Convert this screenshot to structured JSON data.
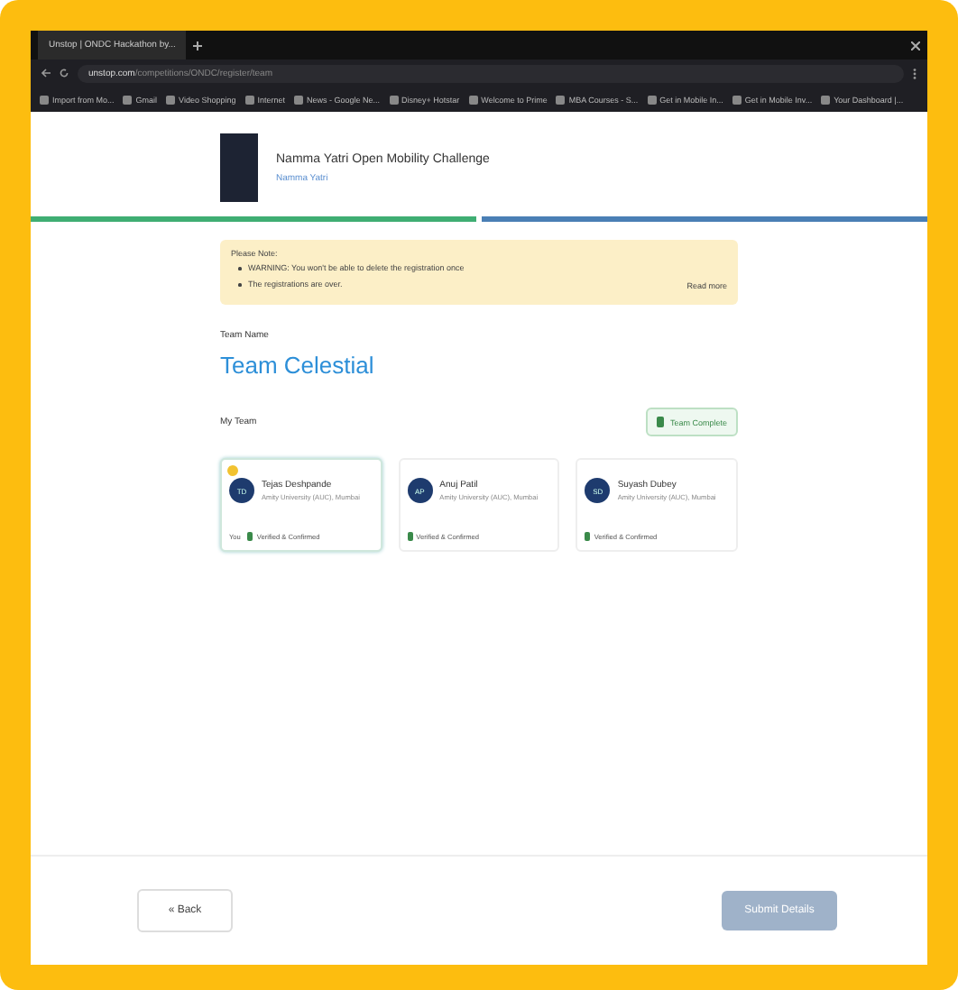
{
  "browser": {
    "tab_title": "Unstop | ONDC Hackathon by...",
    "url_domain": "unstop.com",
    "url_path": "/competitions/ONDC/register/team",
    "bookmarks": [
      "Import from Mo...",
      "Gmail",
      "Video Shopping",
      "Internet",
      "News - Google Ne...",
      "Disney+ Hotstar",
      "Welcome to Prime",
      "MBA Courses - S...",
      "Get in Mobile In...",
      "Get in Mobile Inv...",
      "Your Dashboard |..."
    ]
  },
  "event": {
    "title": "Namma Yatri Open Mobility Challenge",
    "subtitle": "Namma Yatri"
  },
  "steps": [
    {
      "completed": true
    },
    {
      "completed": false
    }
  ],
  "notice": {
    "heading": "Please Note:",
    "items": [
      "WARNING: You won't be able to delete the registration once",
      "The registrations are over."
    ],
    "link": "Read more"
  },
  "team": {
    "label": "Team Name",
    "name": "Team Celestial"
  },
  "members_heading": "My Team",
  "team_status": "Team Complete",
  "members": [
    {
      "initials": "TD",
      "name": "Tejas Deshpande",
      "org": "Amity University (AUC), Mumbai",
      "is_you": true,
      "you_label": "You",
      "status": "Verified & Confirmed",
      "leader": true
    },
    {
      "initials": "AP",
      "name": "Anuj Patil",
      "org": "Amity University (AUC), Mumbai",
      "is_you": false,
      "status": "Verified & Confirmed",
      "leader": false
    },
    {
      "initials": "SD",
      "name": "Suyash Dubey",
      "org": "Amity University (AUC), Mumbai",
      "is_you": false,
      "status": "Verified & Confirmed",
      "leader": false
    }
  ],
  "footer": {
    "back": "« Back",
    "submit": "Submit Details",
    "submit_disabled": true
  }
}
